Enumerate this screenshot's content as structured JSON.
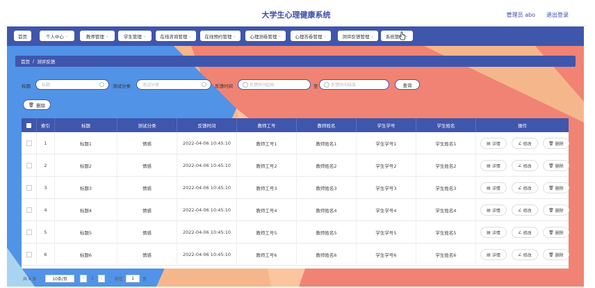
{
  "app": {
    "title": "大学生心理健康系统",
    "user": "管理员 abo",
    "logout": "退出登录"
  },
  "nav": [
    {
      "label": "首页",
      "has_menu": false
    },
    {
      "label": "个人中心",
      "has_menu": true
    },
    {
      "label": "教师管理",
      "has_menu": true
    },
    {
      "label": "学生管理",
      "has_menu": true
    },
    {
      "label": "在线咨询管理",
      "has_menu": true
    },
    {
      "label": "在线预约管理",
      "has_menu": true
    },
    {
      "label": "心理测卷管理",
      "has_menu": true
    },
    {
      "label": "心理答卷管理",
      "has_menu": true
    },
    {
      "label": "测评反馈管理",
      "has_menu": true
    },
    {
      "label": "系统管理",
      "has_menu": true
    }
  ],
  "breadcrumb": {
    "home": "首页",
    "sep": "/",
    "current": "测评反馈"
  },
  "filters": {
    "title_label": "标题",
    "title_placeholder": "标题",
    "category_label": "测试分类",
    "category_placeholder": "测试分类",
    "time_label": "反馈时间",
    "time_start_placeholder": "反馈时间起始",
    "time_to": "至",
    "time_end_placeholder": "反馈时间结束",
    "search_button": "查询"
  },
  "toolbar": {
    "delete_button": "删除"
  },
  "table": {
    "columns": [
      "索引",
      "标题",
      "测试分类",
      "反馈时间",
      "教师工号",
      "教师姓名",
      "学生学号",
      "学生姓名",
      "操作"
    ],
    "actions": {
      "detail": "详情",
      "edit": "修改",
      "delete": "删除"
    },
    "rows": [
      {
        "index": "1",
        "title": "标题1",
        "category": "情感",
        "time": "2022-04-06 10:45:10",
        "teacher_id": "教师工号1",
        "teacher_name": "教师姓名1",
        "student_id": "学生学号1",
        "student_name": "学生姓名1"
      },
      {
        "index": "2",
        "title": "标题2",
        "category": "情感",
        "time": "2022-04-06 10:45:10",
        "teacher_id": "教师工号2",
        "teacher_name": "教师姓名2",
        "student_id": "学生学号2",
        "student_name": "学生姓名2"
      },
      {
        "index": "3",
        "title": "标题3",
        "category": "情感",
        "time": "2022-04-06 10:45:10",
        "teacher_id": "教师工号3",
        "teacher_name": "教师姓名3",
        "student_id": "学生学号3",
        "student_name": "学生姓名3"
      },
      {
        "index": "4",
        "title": "标题4",
        "category": "情感",
        "time": "2022-04-06 10:45:10",
        "teacher_id": "教师工号4",
        "teacher_name": "教师姓名4",
        "student_id": "学生学号4",
        "student_name": "学生姓名4"
      },
      {
        "index": "5",
        "title": "标题5",
        "category": "情感",
        "time": "2022-04-06 10:45:10",
        "teacher_id": "教师工号5",
        "teacher_name": "教师姓名5",
        "student_id": "学生学号5",
        "student_name": "学生姓名5"
      },
      {
        "index": "6",
        "title": "标题6",
        "category": "情感",
        "time": "2022-04-06 10:45:10",
        "teacher_id": "教师工号6",
        "teacher_name": "教师姓名6",
        "student_id": "学生学号6",
        "student_name": "学生姓名6"
      }
    ]
  },
  "pager": {
    "total": "共 6 条",
    "page_size": "10条/页",
    "current_page": "1",
    "goto_label": "前往",
    "goto_value": "1",
    "page_suffix": "页"
  },
  "colors": {
    "primary": "#3f56ad",
    "bg_blue": "#4f8fe6",
    "bg_peach": "#f5b58a",
    "bg_coral": "#f08070"
  },
  "icons": {
    "nav_chevron": "chevron-down-icon",
    "delete": "trash-icon",
    "detail": "document-icon",
    "edit": "pencil-icon",
    "clock": "clock-icon",
    "cursor": "pointer-hand-icon"
  }
}
